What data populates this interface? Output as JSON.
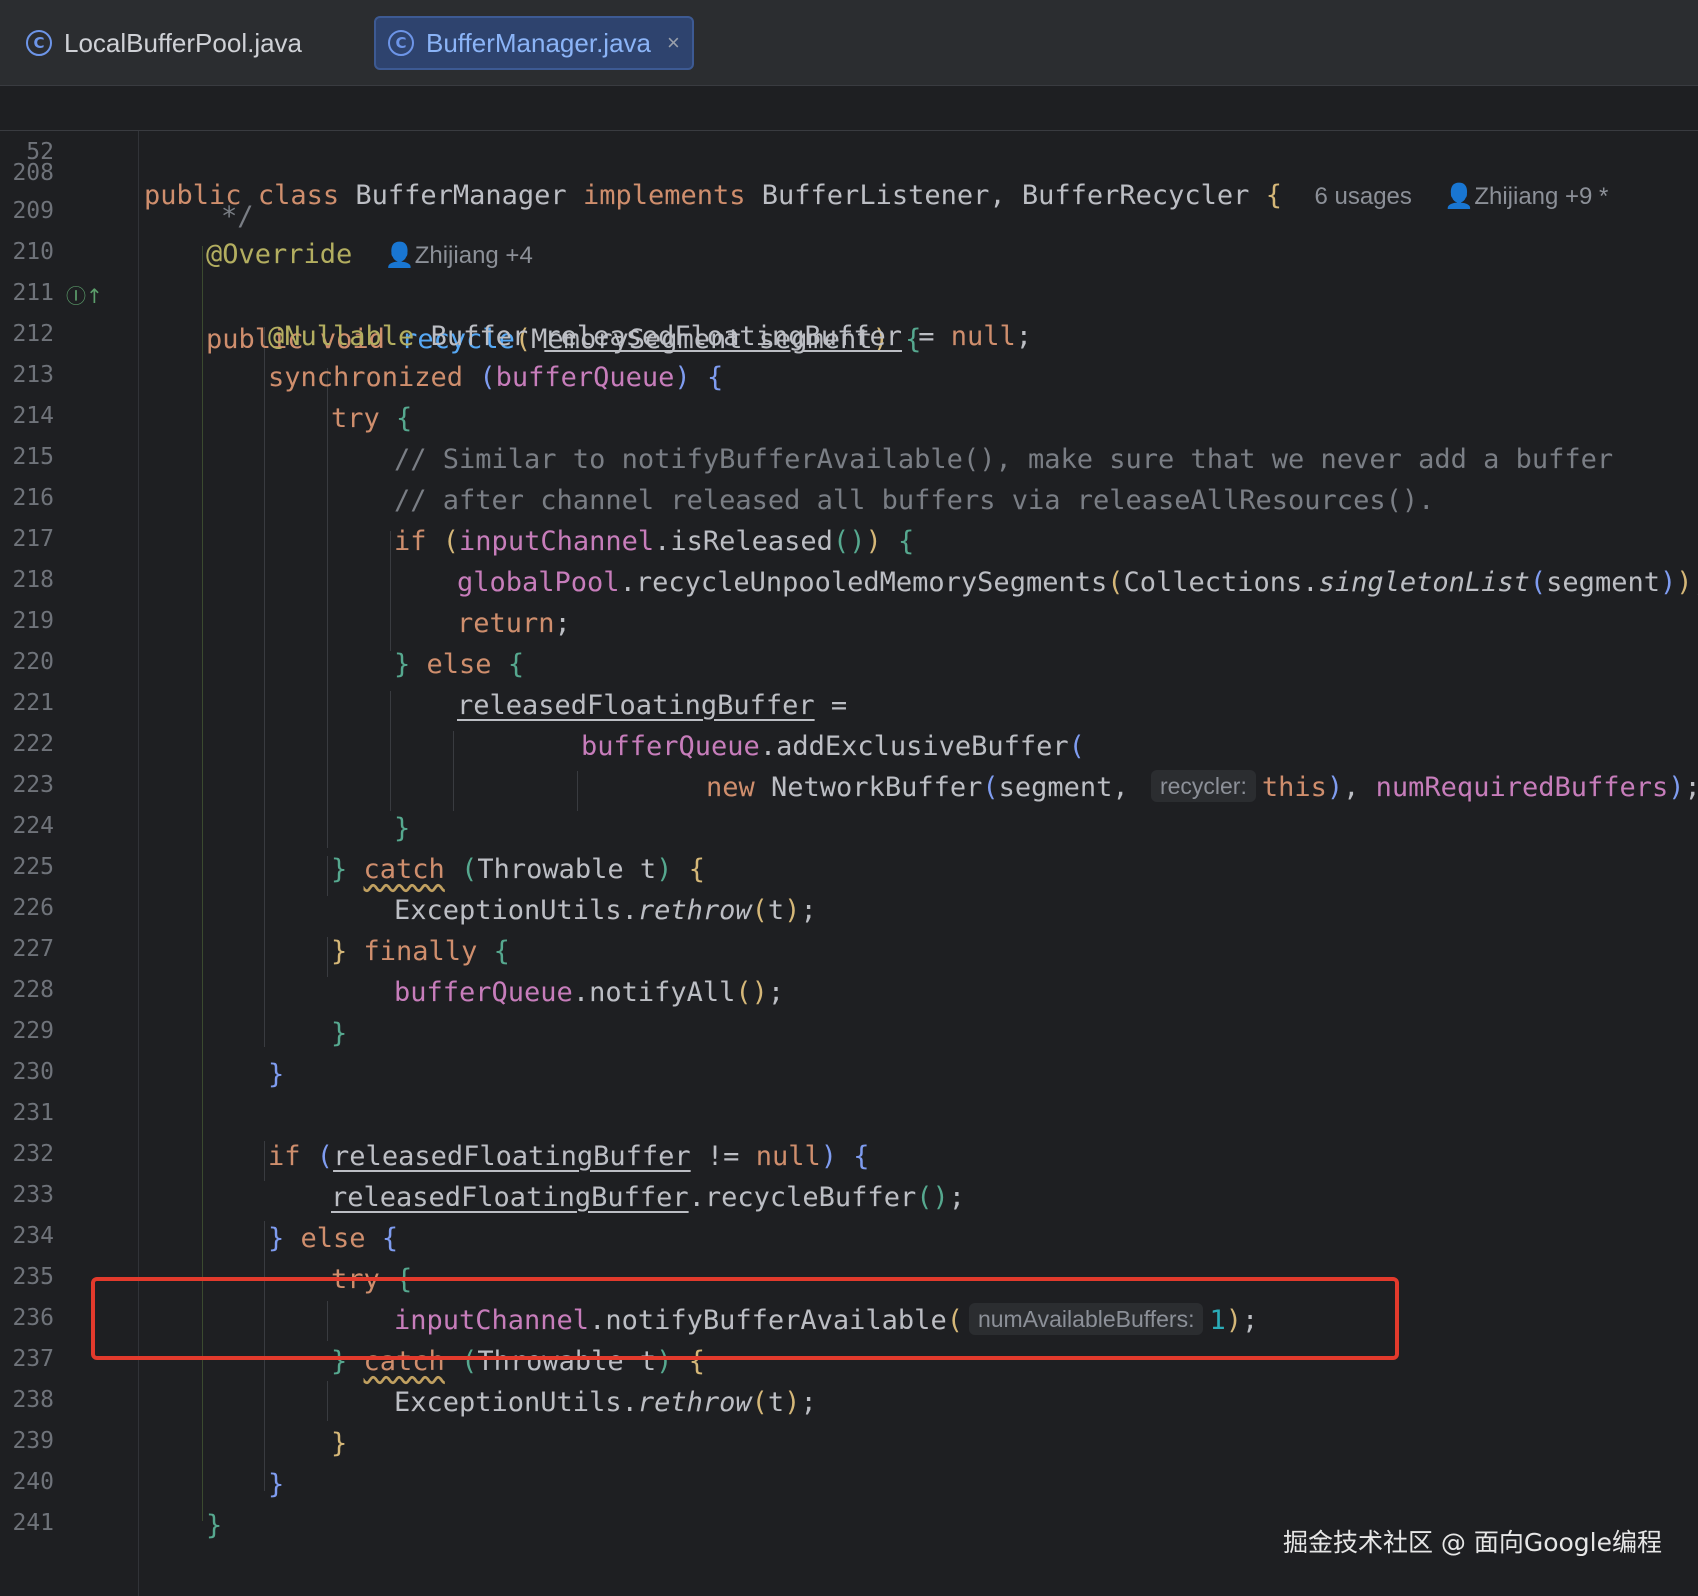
{
  "tabs": [
    {
      "label": "LocalBufferPool.java",
      "icon": "C",
      "active": false
    },
    {
      "label": "BufferManager.java",
      "icon": "C",
      "active": true,
      "close": "×"
    }
  ],
  "sticky": {
    "line_no": "52",
    "kw1": "public",
    "kw2": "class",
    "name": "BufferManager",
    "kw3": "implements",
    "ifaces": "BufferListener, BufferRecycler",
    "brace": "{",
    "usages": "6 usages",
    "author": "Zhijiang +9 *"
  },
  "lines": {
    "n208": "208",
    "t208": "*/",
    "n209": "209",
    "t209": "@Override",
    "a209": "Zhijiang +4",
    "n210": "210",
    "n211": "211",
    "n212": "212",
    "n213": "213",
    "n214": "214",
    "n215": "215",
    "n216": "216",
    "n217": "217",
    "n218": "218",
    "n219": "219",
    "n220": "220",
    "n221": "221",
    "n222": "222",
    "n223": "223",
    "n224": "224",
    "n225": "225",
    "n226": "226",
    "n227": "227",
    "n228": "228",
    "n229": "229",
    "n230": "230",
    "n231": "231",
    "n232": "232",
    "n233": "233",
    "n234": "234",
    "n235": "235",
    "n236": "236",
    "n237": "237",
    "n238": "238",
    "n239": "239",
    "n240": "240",
    "n241": "241",
    "c214": "// Similar to notifyBufferAvailable(), make sure that we never add a buffer",
    "c215": "// after channel released all buffers via releaseAllResources().",
    "hint222": "recycler:",
    "hint235": "numAvailableBuffers:"
  },
  "watermark": "掘金技术社区 @ 面向Google编程",
  "colors": {
    "background": "#1e1f22",
    "keyword": "#cf8e6d",
    "function": "#56a8f5",
    "field": "#c77dbb",
    "annotation": "#b3ae60",
    "highlight_box": "#e33a2c"
  },
  "icons": {
    "tab_class": "class-icon",
    "impl_marker": "implements-method-icon",
    "author": "user-icon"
  }
}
